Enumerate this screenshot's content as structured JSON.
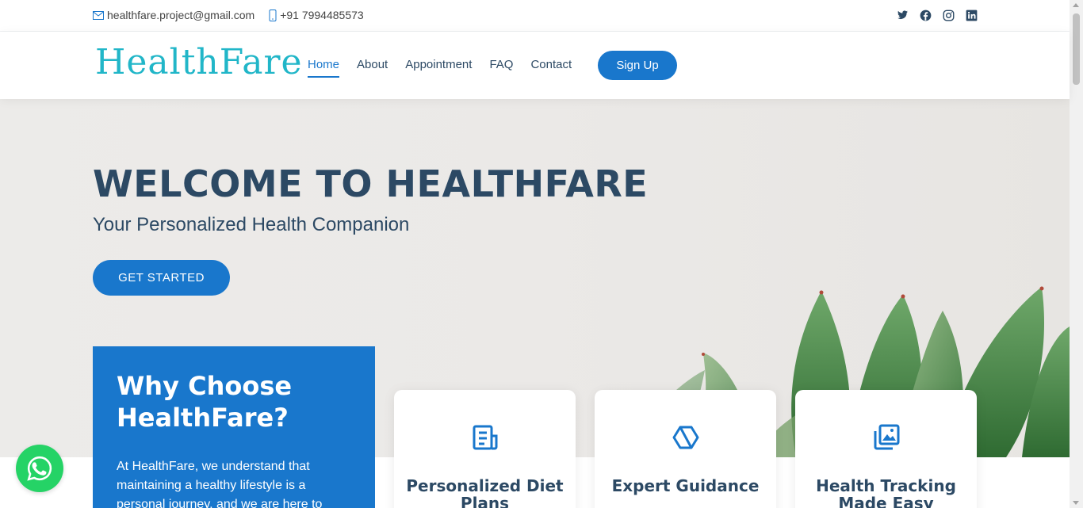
{
  "topbar": {
    "email": "healthfare.project@gmail.com",
    "phone": "+91 7994485573",
    "social_icons": [
      "twitter-icon",
      "facebook-icon",
      "instagram-icon",
      "linkedin-icon"
    ]
  },
  "header": {
    "logo": "HealthFare",
    "nav": [
      {
        "label": "Home",
        "active": true
      },
      {
        "label": "About",
        "active": false
      },
      {
        "label": "Appointment",
        "active": false
      },
      {
        "label": "FAQ",
        "active": false
      },
      {
        "label": "Contact",
        "active": false
      }
    ],
    "signup_label": "Sign Up"
  },
  "hero": {
    "title": "WELCOME TO HEALTHFARE",
    "subtitle": "Your Personalized Health Companion",
    "cta_label": "GET STARTED"
  },
  "why": {
    "title": "Why Choose HealthFare?",
    "text": "At HealthFare, we understand that maintaining a healthy lifestyle is a personal journey, and we are here to"
  },
  "cards": [
    {
      "icon": "document-icon",
      "title": "Personalized Diet Plans"
    },
    {
      "icon": "hexagon-icon",
      "title": "Expert Guidance"
    },
    {
      "icon": "images-icon",
      "title": "Health Tracking Made Easy"
    }
  ],
  "colors": {
    "primary": "#1977cc",
    "heading": "#2c4964",
    "logo": "#21b6c8",
    "whatsapp": "#25d366"
  }
}
